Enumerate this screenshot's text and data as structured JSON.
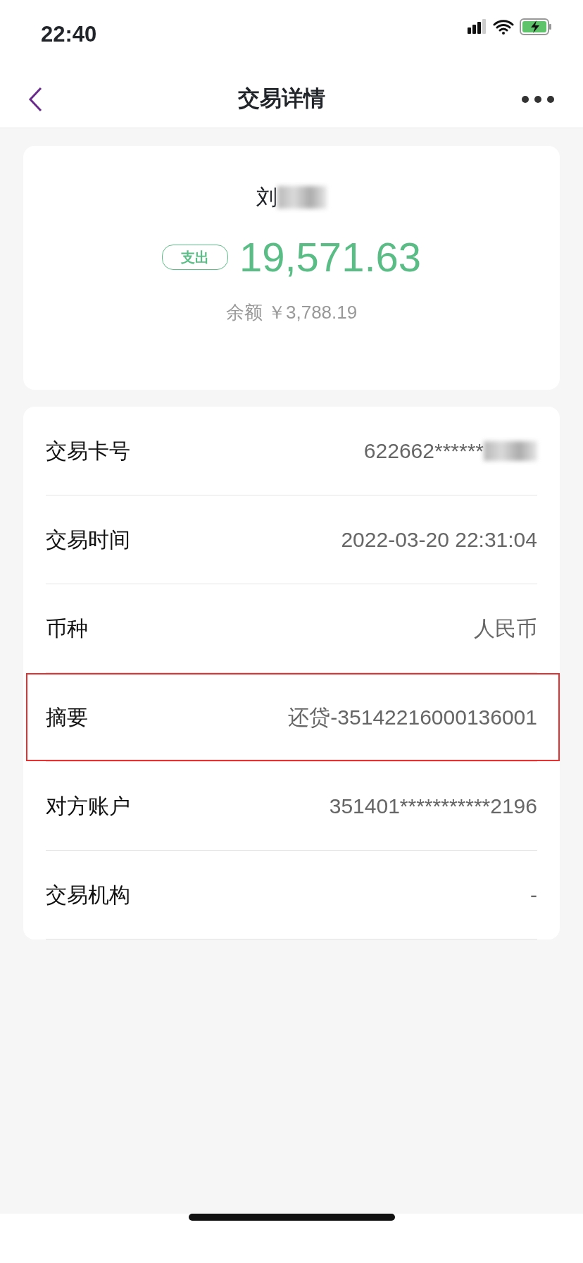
{
  "status_bar": {
    "time": "22:40"
  },
  "nav": {
    "title": "交易详情"
  },
  "summary": {
    "name": "刘",
    "name_redacted": true,
    "badge": "支出",
    "amount": "19,571.63",
    "balance": "余额 ￥3,788.19"
  },
  "details": [
    {
      "label": "交易卡号",
      "value": "622662******",
      "redacted": true,
      "highlighted": false
    },
    {
      "label": "交易时间",
      "value": "2022-03-20 22:31:04",
      "redacted": false,
      "highlighted": false
    },
    {
      "label": "币种",
      "value": "人民币",
      "redacted": false,
      "highlighted": false
    },
    {
      "label": "摘要",
      "value": "还贷-35142216000136001",
      "redacted": false,
      "highlighted": true
    },
    {
      "label": "对方账户",
      "value": "351401***********2196",
      "redacted": false,
      "highlighted": false
    },
    {
      "label": "交易机构",
      "value": "-",
      "redacted": false,
      "highlighted": false
    }
  ]
}
